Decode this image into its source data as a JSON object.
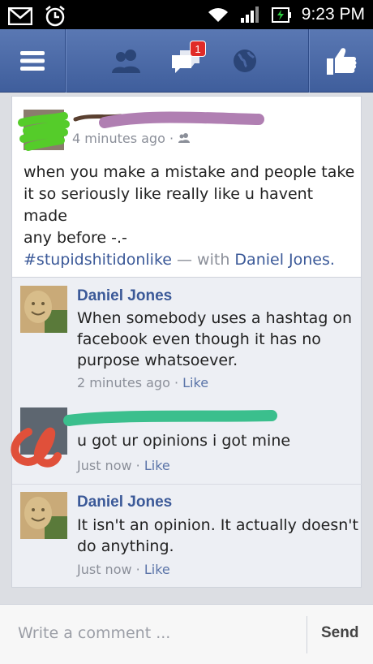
{
  "status_bar": {
    "time": "9:23 PM"
  },
  "navbar": {
    "notification_count": "1"
  },
  "post": {
    "timestamp": "4 minutes ago ·",
    "text_line1": "when you make a mistake and people take",
    "text_line2": "it so seriously like really like u havent made",
    "text_line3": "any before -.-",
    "hashtag": "#stupidshitidonlike",
    "with_label": "— with",
    "tagged_name": "Daniel Jones."
  },
  "comments": [
    {
      "name": "Daniel Jones",
      "line1": "When somebody uses a hashtag on",
      "line2": "facebook even though it has no",
      "line3": "purpose whatsoever.",
      "time": "2 minutes ago ·",
      "like": "Like"
    },
    {
      "name": "",
      "line1": "u got ur opinions i got mine",
      "time": "Just now ·",
      "like": "Like"
    },
    {
      "name": "Daniel Jones",
      "line1": "It isn't an opinion. It actually doesn't",
      "line2": "do anything.",
      "time": "Just now ·",
      "like": "Like"
    }
  ],
  "composer": {
    "placeholder": "Write a comment ...",
    "send": "Send"
  },
  "colors": {
    "nav": "#3f5e9c",
    "link": "#3b5998",
    "badge": "#e02b27"
  }
}
